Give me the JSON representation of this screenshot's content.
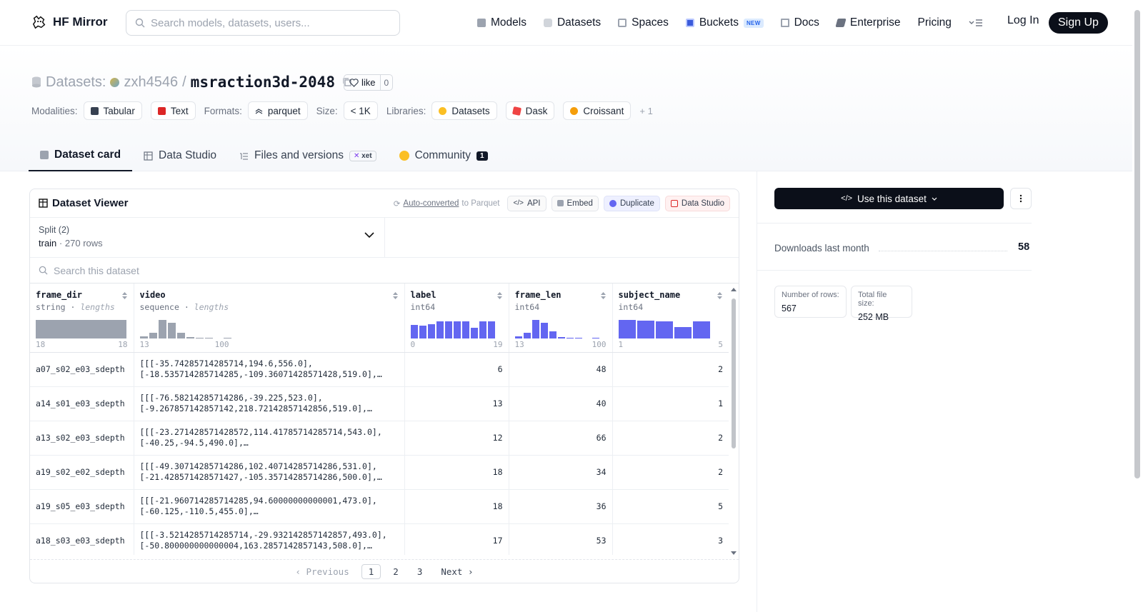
{
  "nav": {
    "brand": "HF Mirror",
    "search_placeholder": "Search models, datasets, users...",
    "items": [
      "Models",
      "Datasets",
      "Spaces",
      "Buckets",
      "Docs",
      "Enterprise",
      "Pricing"
    ],
    "buckets_badge": "NEW",
    "login": "Log In",
    "signup": "Sign Up"
  },
  "header": {
    "prefix": "Datasets:",
    "owner": "zxh4546",
    "sep": "/",
    "name": "msraction3d-2048",
    "like_label": "like",
    "like_count": "0"
  },
  "meta": {
    "modalities_label": "Modalities:",
    "modalities": [
      "Tabular",
      "Text"
    ],
    "formats_label": "Formats:",
    "formats": [
      "parquet"
    ],
    "size_label": "Size:",
    "size": "< 1K",
    "libraries_label": "Libraries:",
    "libraries": [
      "Datasets",
      "Dask",
      "Croissant"
    ],
    "more": "+ 1"
  },
  "tabs": {
    "dataset_card": "Dataset card",
    "data_studio": "Data Studio",
    "files": "Files and versions",
    "xet": "xet",
    "community": "Community",
    "community_count": "1"
  },
  "viewer": {
    "title": "Dataset Viewer",
    "auto_converted": "Auto-converted",
    "to_parquet": "to Parquet",
    "api": "API",
    "embed": "Embed",
    "duplicate": "Duplicate",
    "data_studio": "Data Studio",
    "split_label": "Split (2)",
    "split_value": "train",
    "split_dot": "·",
    "split_rows": "270 rows",
    "search_placeholder": "Search this dataset",
    "columns": [
      {
        "name": "frame_dir",
        "type": "string",
        "sub": "lengths",
        "min": "18",
        "max": "18"
      },
      {
        "name": "video",
        "type": "sequence",
        "sub": "lengths",
        "min": "13",
        "max": "100"
      },
      {
        "name": "label",
        "type": "int64",
        "sub": "",
        "min": "0",
        "max": "19"
      },
      {
        "name": "frame_len",
        "type": "int64",
        "sub": "",
        "min": "13",
        "max": "100"
      },
      {
        "name": "subject_name",
        "type": "int64",
        "sub": "",
        "min": "1",
        "max": "5"
      }
    ],
    "rows": [
      {
        "frame_dir": "a07_s02_e03_sdepth",
        "video": "[[[-35.74285714285714,194.6,556.0],\n[-18.535714285714285,-109.36071428571428,519.0],…",
        "label": "6",
        "frame_len": "48",
        "subject_name": "2"
      },
      {
        "frame_dir": "a14_s01_e03_sdepth",
        "video": "[[[-76.58214285714286,-39.225,523.0],\n[-9.267857142857142,218.72142857142856,519.0],…",
        "label": "13",
        "frame_len": "40",
        "subject_name": "1"
      },
      {
        "frame_dir": "a13_s02_e03_sdepth",
        "video": "[[[-23.271428571428572,114.41785714285714,543.0],\n[-40.25,-94.5,490.0],…",
        "label": "12",
        "frame_len": "66",
        "subject_name": "2"
      },
      {
        "frame_dir": "a19_s02_e02_sdepth",
        "video": "[[[-49.30714285714286,102.40714285714286,531.0],\n[-21.428571428571427,-105.35714285714286,500.0],…",
        "label": "18",
        "frame_len": "34",
        "subject_name": "2"
      },
      {
        "frame_dir": "a19_s05_e03_sdepth",
        "video": "[[[-21.960714285714285,94.60000000000001,473.0],\n[-60.125,-110.5,455.0],…",
        "label": "18",
        "frame_len": "36",
        "subject_name": "5"
      },
      {
        "frame_dir": "a18_s03_e03_sdepth",
        "video": "[[[-3.5214285714285714,-29.932142857142857,493.0],\n[-50.800000000000004,163.2857142857143,508.0],…",
        "label": "17",
        "frame_len": "53",
        "subject_name": "3"
      }
    ],
    "pager": {
      "prev": "Previous",
      "pages": [
        "1",
        "2",
        "3"
      ],
      "next": "Next"
    }
  },
  "sidebar": {
    "use_button": "Use this dataset",
    "downloads_label": "Downloads last month",
    "downloads_value": "58",
    "rows_label": "Number of rows:",
    "rows_value": "567",
    "size_label": "Total file size:",
    "size_value": "252 MB"
  },
  "colors": {
    "accent": "#6366f1",
    "dark": "#0b0f19",
    "muted": "#9ca3af"
  }
}
